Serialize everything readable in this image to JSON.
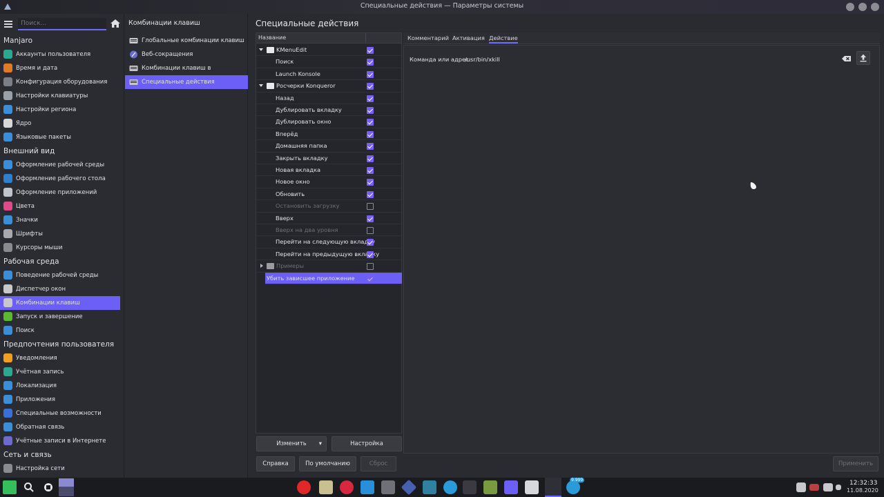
{
  "window": {
    "title": "Специальные действия — Параметры системы"
  },
  "sidebar": {
    "search_placeholder": "Поиск...",
    "categories": [
      "Manjaro",
      "Внешний вид",
      "Рабочая среда",
      "Предпочтения пользователя",
      "Сеть и связь"
    ],
    "items": [
      {
        "label": "Аккаунты пользователя",
        "color": "#2aa890"
      },
      {
        "label": "Время и дата",
        "color": "#e07a24"
      },
      {
        "label": "Конфигурация оборудования",
        "color": "#7a7f88"
      },
      {
        "label": "Настройки клавиатуры",
        "color": "#9aa0a8"
      },
      {
        "label": "Настройки региона",
        "color": "#3a8fd8"
      },
      {
        "label": "Ядро",
        "color": "#d8d8d8"
      },
      {
        "label": "Языковые пакеты",
        "color": "#3a8fd8"
      },
      {
        "label": "Оформление рабочей среды",
        "color": "#3a8fd8"
      },
      {
        "label": "Оформление рабочего стола",
        "color": "#2d7fd0"
      },
      {
        "label": "Оформление приложений",
        "color": "#c0c4cc"
      },
      {
        "label": "Цвета",
        "color": "#e04a8a"
      },
      {
        "label": "Значки",
        "color": "#3a8fd8"
      },
      {
        "label": "Шрифты",
        "color": "#a8a8b0"
      },
      {
        "label": "Курсоры мыши",
        "color": "#8a8a90"
      },
      {
        "label": "Поведение рабочей среды",
        "color": "#3a8fd8"
      },
      {
        "label": "Диспетчер окон",
        "color": "#c8c8cc"
      },
      {
        "label": "Комбинации клавиш",
        "color": "#c8c8cc"
      },
      {
        "label": "Запуск и завершение",
        "color": "#5ab830"
      },
      {
        "label": "Поиск",
        "color": "#3a8fd8"
      },
      {
        "label": "Уведомления",
        "color": "#f0a020"
      },
      {
        "label": "Учётная запись",
        "color": "#2aa890"
      },
      {
        "label": "Локализация",
        "color": "#3a8fd8"
      },
      {
        "label": "Приложения",
        "color": "#3a8fd8"
      },
      {
        "label": "Специальные возможности",
        "color": "#3a6fd8"
      },
      {
        "label": "Обратная связь",
        "color": "#3a8fd8"
      },
      {
        "label": "Учётные записи в Интернете",
        "color": "#6b6bd0"
      },
      {
        "label": "Настройка сети",
        "color": "#8a8a90"
      }
    ]
  },
  "middle": {
    "title": "Комбинации клавиш",
    "items": [
      "Глобальные комбинации клавиш",
      "Веб-сокращения",
      "Комбинации клавиш в приложениях",
      "Специальные действия"
    ]
  },
  "main": {
    "title": "Специальные действия",
    "tree_header": "Название",
    "tree": [
      {
        "label": "KMenuEdit",
        "level": 0,
        "folder": true,
        "expanded": true,
        "checked": true,
        "disabled": false
      },
      {
        "label": "Поиск",
        "level": 1,
        "checked": true,
        "disabled": false
      },
      {
        "label": "Launch Konsole",
        "level": 1,
        "checked": true,
        "disabled": false
      },
      {
        "label": "Росчерки Konqueror",
        "level": 0,
        "folder": true,
        "expanded": true,
        "checked": true,
        "disabled": false
      },
      {
        "label": "Назад",
        "level": 1,
        "checked": true,
        "disabled": false
      },
      {
        "label": "Дублировать вкладку",
        "level": 1,
        "checked": true,
        "disabled": false
      },
      {
        "label": "Дублировать окно",
        "level": 1,
        "checked": true,
        "disabled": false
      },
      {
        "label": "Вперёд",
        "level": 1,
        "checked": true,
        "disabled": false
      },
      {
        "label": "Домашняя папка",
        "level": 1,
        "checked": true,
        "disabled": false
      },
      {
        "label": "Закрыть вкладку",
        "level": 1,
        "checked": true,
        "disabled": false
      },
      {
        "label": "Новая вкладка",
        "level": 1,
        "checked": true,
        "disabled": false
      },
      {
        "label": "Новое окно",
        "level": 1,
        "checked": true,
        "disabled": false
      },
      {
        "label": "Обновить",
        "level": 1,
        "checked": true,
        "disabled": false
      },
      {
        "label": "Остановить загрузку",
        "level": 1,
        "checked": false,
        "disabled": true
      },
      {
        "label": "Вверх",
        "level": 1,
        "checked": true,
        "disabled": false
      },
      {
        "label": "Вверх на два уровня",
        "level": 1,
        "checked": false,
        "disabled": true
      },
      {
        "label": "Перейти на следующую вкладку",
        "level": 1,
        "checked": true,
        "disabled": false
      },
      {
        "label": "Перейти на предыдущую вкладку",
        "level": 1,
        "checked": true,
        "disabled": false
      },
      {
        "label": "Примеры",
        "level": 0,
        "folder": true,
        "expanded": false,
        "checked": false,
        "disabled": true
      },
      {
        "label": "Убить зависшее приложение",
        "level": 0,
        "checked": true,
        "disabled": false,
        "selected": true
      }
    ],
    "buttons": {
      "edit": "Изменить",
      "settings": "Настройка",
      "help": "Справка",
      "defaults": "По умолчанию",
      "reset": "Сброс",
      "apply": "Применить"
    },
    "tabs": [
      "Комментарий",
      "Активация",
      "Действие"
    ],
    "active_tab": "Действие",
    "command_label": "Команда или адрес:",
    "command_value": "/usr/bin/xkill"
  },
  "taskbar": {
    "time": "12:32:33",
    "date": "11.08.2020",
    "badge": "9.999"
  }
}
